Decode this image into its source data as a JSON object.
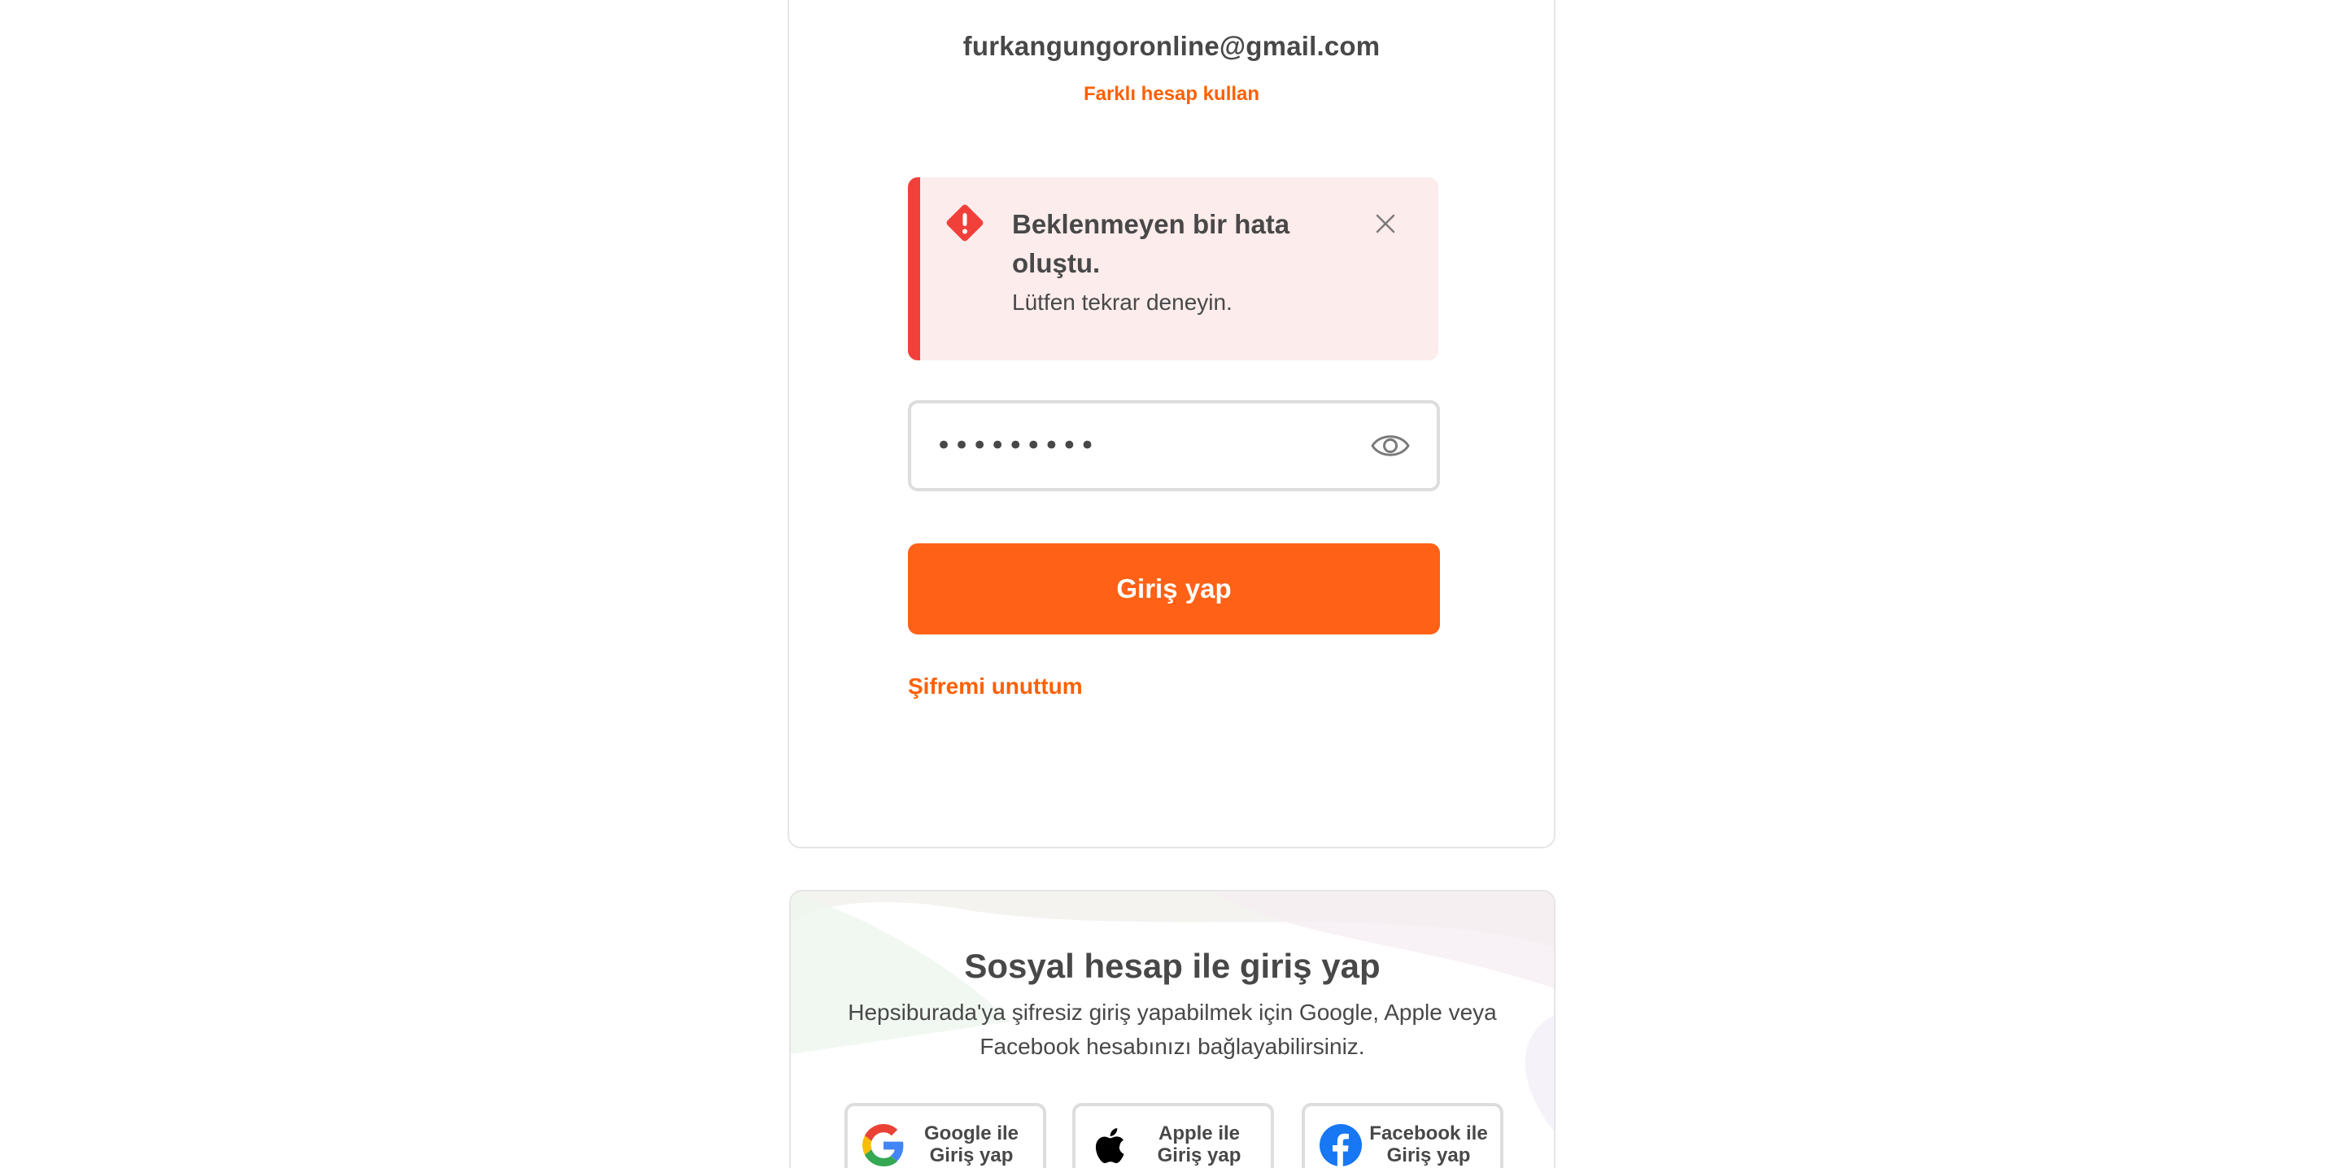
{
  "login": {
    "email": "furkangungoronline@gmail.com",
    "switch_account_label": "Farklı hesap kullan",
    "alert": {
      "title": "Beklenmeyen bir hata oluştu.",
      "message": "Lütfen tekrar deneyin.",
      "icon": "warning-diamond-icon",
      "color": "#f1403a",
      "background": "#fdecec"
    },
    "password": {
      "value": "•••••••••",
      "toggle_icon": "eye-icon"
    },
    "submit_label": "Giriş yap",
    "forgot_label": "Şifremi unuttum",
    "accent_color": "#ff6000"
  },
  "social": {
    "title": "Sosyal hesap ile giriş yap",
    "description": "Hepsiburada'ya şifresiz giriş yapabilmek için Google, Apple veya Facebook hesabınızı bağlayabilirsiniz.",
    "buttons": [
      {
        "label": "Google ile Giriş yap",
        "icon": "google-icon"
      },
      {
        "label": "Apple ile Giriş yap",
        "icon": "apple-icon"
      },
      {
        "label": "Facebook ile Giriş yap",
        "icon": "facebook-icon"
      }
    ]
  }
}
